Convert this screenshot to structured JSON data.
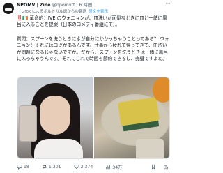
{
  "tweet": {
    "author_name": "NPOMV | Zine",
    "handle": "@npomvtt",
    "time": "6 時間",
    "translation_note": "Grok によるポルトガル語からの翻訳",
    "show_original": "原文を表示",
    "paragraph_1": "‼️🇮🇪 革命的：IVE のウォニョンが、皿洗いが面倒なときに皿と一緒に風呂に入ることを提案（日本のコメディ番組にて）。",
    "paragraph_2": "質問：スプーンを洗うときに水が自分にかかっちゃうことってある？ ウォニョン：それにはコツがあるんです。仕事から疲れて帰ってきて、皿洗いが問題になるじゃないですか。だから、スプーンを洗うときは一緒に風呂に入っちゃうんです。それにこれで時間も節約できるし、完璧ですよね。",
    "media_alt": [
      "woman selfie",
      "sponge and dish"
    ],
    "actions": {
      "replies": "18",
      "reposts": "1,301",
      "likes": "2,374",
      "views": "34万"
    }
  }
}
